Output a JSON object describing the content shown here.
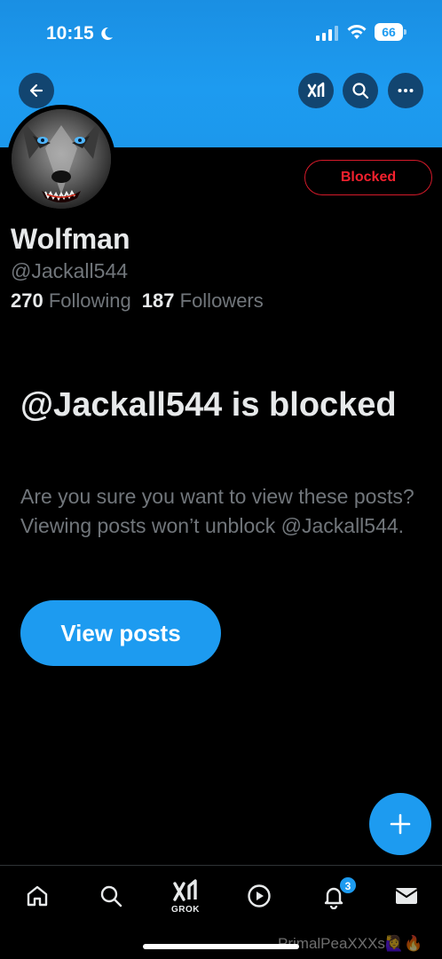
{
  "status_bar": {
    "time": "10:15",
    "battery": "66"
  },
  "header": {
    "back_icon": "arrow-left-icon",
    "grok_icon": "grok-icon",
    "search_icon": "search-icon",
    "more_icon": "more-horizontal-icon"
  },
  "profile": {
    "display_name": "Wolfman",
    "handle": "@Jackall544",
    "following_count": "270",
    "following_label": "Following",
    "followers_count": "187",
    "followers_label": "Followers",
    "blocked_button_label": "Blocked"
  },
  "blocked_notice": {
    "title": "@Jackall544 is blocked",
    "description": "Are you sure you want to view these posts? Viewing posts won’t unblock @Jackall544.",
    "view_posts_label": "View posts"
  },
  "tab_bar": {
    "items": [
      {
        "name": "home",
        "icon": "home-icon"
      },
      {
        "name": "search",
        "icon": "search-icon"
      },
      {
        "name": "grok",
        "icon": "grok-icon",
        "label": "GROK"
      },
      {
        "name": "video",
        "icon": "play-icon"
      },
      {
        "name": "notifications",
        "icon": "bell-icon",
        "badge": "3"
      },
      {
        "name": "messages",
        "icon": "mail-icon"
      }
    ]
  },
  "watermark": "PrimalPeaXXXs🙋‍♀️🔥",
  "colors": {
    "accent": "#1d9bf0",
    "blocked_red": "#f4212e",
    "background": "#000000",
    "muted_text": "#71767b"
  }
}
